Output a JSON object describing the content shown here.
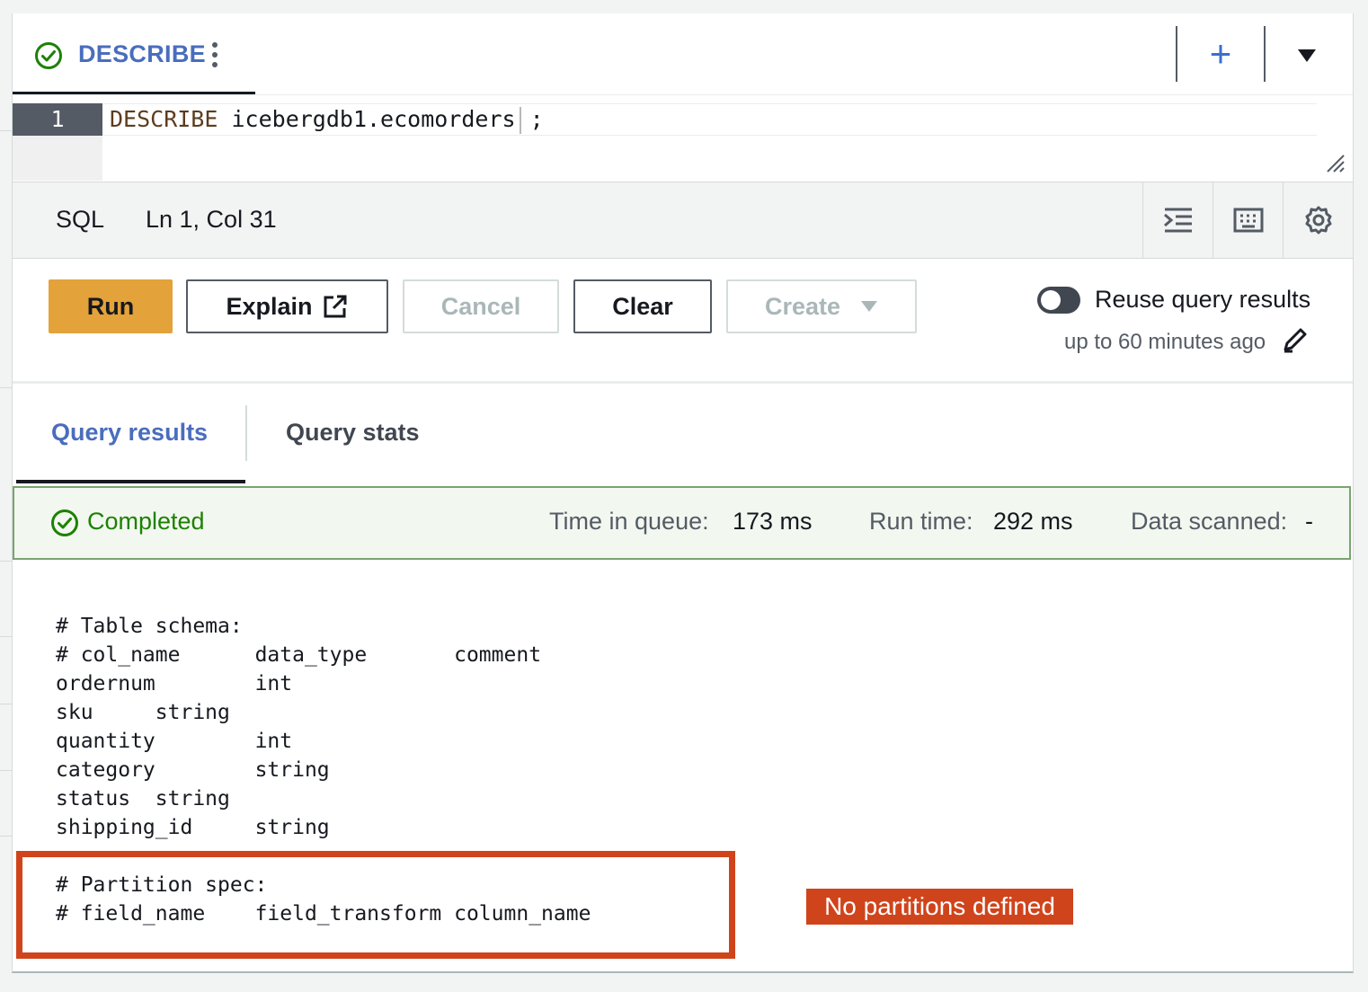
{
  "query_tab": {
    "name": "DESCRIBE"
  },
  "editor": {
    "line_number": "1",
    "keyword": "DESCRIBE",
    "statement_rest": "icebergdb1.ecomorders",
    "terminator": ";"
  },
  "statusbar": {
    "language": "SQL",
    "position": "Ln 1, Col 31"
  },
  "actions": {
    "run": "Run",
    "explain": "Explain",
    "cancel": "Cancel",
    "clear": "Clear",
    "create": "Create",
    "reuse_label": "Reuse query results",
    "reuse_sub": "up to 60 minutes ago",
    "reuse_enabled": false
  },
  "results_tabs": [
    "Query results",
    "Query stats"
  ],
  "status": {
    "text": "Completed",
    "queue_label": "Time in queue:",
    "queue_value": "173 ms",
    "run_label": "Run time:",
    "run_value": "292 ms",
    "scanned_label": "Data scanned:",
    "scanned_value": "-"
  },
  "output": {
    "schema_header": "# Table schema:",
    "columns_header": "# col_name\tdata_type\tcomment",
    "rows": [
      "ordernum\tint",
      "sku\tstring",
      "quantity\tint",
      "category\tstring",
      "status\tstring",
      "shipping_id\tstring"
    ],
    "partition_header": "# Partition spec:",
    "partition_columns": "# field_name\tfield_transform\tcolumn_name"
  },
  "annotation": {
    "label": "No partitions defined"
  },
  "colors": {
    "accent": "#e3a23a",
    "success": "#1d8102",
    "link": "#4a6dbd",
    "callout": "#d0441c"
  }
}
